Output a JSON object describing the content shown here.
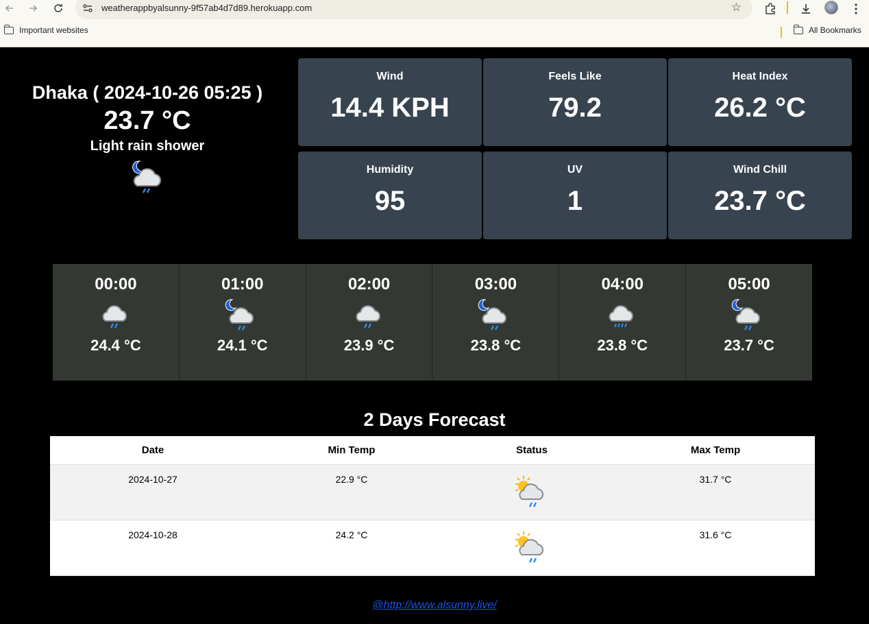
{
  "browser": {
    "url": "weatherappbyalsunny-9f57ab4d7d89.herokuapp.com",
    "bookmarks": [
      "Important websites"
    ],
    "all_bookmarks": "All Bookmarks"
  },
  "current": {
    "title": "Dhaka ( 2024-10-26 05:25 )",
    "temp": "23.7 °C",
    "condition": "Light rain shower",
    "icon": "night-rain-cloud-icon"
  },
  "stats": [
    {
      "label": "Wind",
      "value": "14.4 KPH"
    },
    {
      "label": "Feels Like",
      "value": "79.2"
    },
    {
      "label": "Heat Index",
      "value": "26.2 °C"
    },
    {
      "label": "Humidity",
      "value": "95"
    },
    {
      "label": "UV",
      "value": "1"
    },
    {
      "label": "Wind Chill",
      "value": "23.7 °C"
    }
  ],
  "hourly": [
    {
      "time": "00:00",
      "temp": "24.4 °C",
      "icon": "rain-cloud-icon"
    },
    {
      "time": "01:00",
      "temp": "24.1 °C",
      "icon": "night-rain-cloud-icon"
    },
    {
      "time": "02:00",
      "temp": "23.9 °C",
      "icon": "rain-cloud-icon"
    },
    {
      "time": "03:00",
      "temp": "23.8 °C",
      "icon": "night-rain-cloud-icon"
    },
    {
      "time": "04:00",
      "temp": "23.8 °C",
      "icon": "heavy-rain-cloud-icon"
    },
    {
      "time": "05:00",
      "temp": "23.7 °C",
      "icon": "night-rain-cloud-icon"
    }
  ],
  "forecast": {
    "title": "2 Days Forecast",
    "headers": [
      "Date",
      "Min Temp",
      "Status",
      "Max Temp"
    ],
    "rows": [
      {
        "date": "2024-10-27",
        "min": "22.9 °C",
        "icon": "sun-rain-cloud-icon",
        "max": "31.7 °C"
      },
      {
        "date": "2024-10-28",
        "min": "24.2 °C",
        "icon": "sun-rain-cloud-icon",
        "max": "31.6 °C"
      }
    ]
  },
  "footer": {
    "link": "@http://www.alsunny.live/"
  },
  "colors": {
    "stat_bg": "#37444f",
    "hourly_bg": "#343833",
    "link": "#1a55e3"
  }
}
